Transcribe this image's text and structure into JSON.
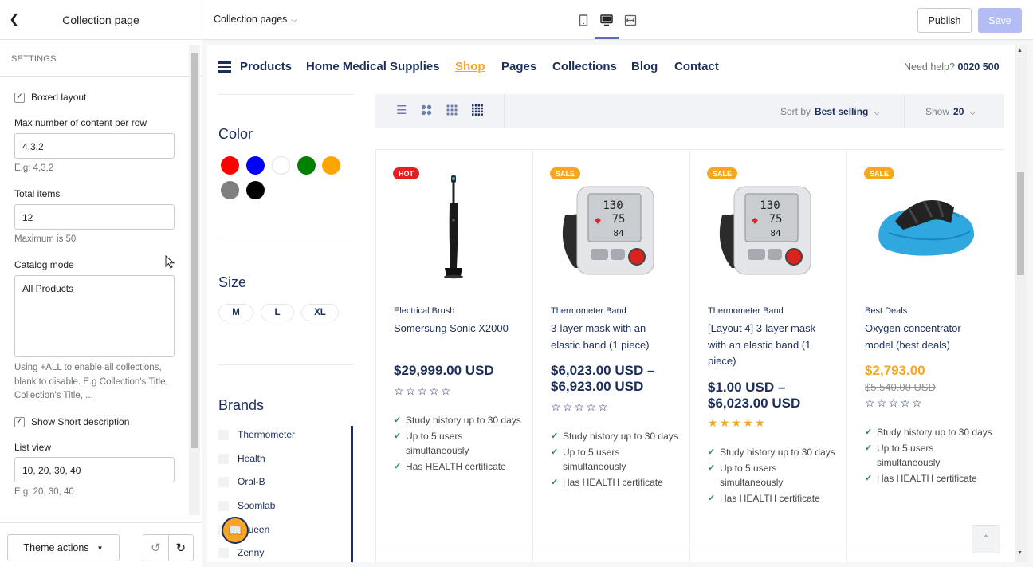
{
  "header": {
    "back_icon": "chevron-left-icon",
    "title": "Collection page"
  },
  "settings": {
    "section_title": "SETTINGS",
    "boxed_layout": {
      "label": "Boxed layout",
      "checked": true
    },
    "max_per_row": {
      "label": "Max number of content per row",
      "value": "4,3,2",
      "hint": "E.g: 4,3,2"
    },
    "total_items": {
      "label": "Total items",
      "value": "12",
      "hint": "Maximum is 50"
    },
    "catalog_mode": {
      "label": "Catalog mode",
      "value": "All Products",
      "hint": "Using +ALL to enable all collections, blank to disable. E.g Collection's Title, Collection's Title, ..."
    },
    "short_desc": {
      "label": "Show Short description",
      "checked": true
    },
    "list_view": {
      "label": "List view",
      "value": "10, 20, 30, 40",
      "hint": "E.g: 20, 30, 40"
    }
  },
  "footer": {
    "theme_actions": "Theme actions",
    "undo_icon": "undo-icon",
    "redo_icon": "redo-icon"
  },
  "topbar": {
    "template_selector": "Collection pages",
    "devices": [
      "mobile-icon",
      "desktop-icon",
      "fullwidth-icon"
    ],
    "active_device": "desktop",
    "publish": "Publish",
    "save": "Save"
  },
  "store": {
    "nav": [
      "Products",
      "Home Medical Supplies",
      "Shop",
      "Pages",
      "Collections",
      "Blog",
      "Contact"
    ],
    "active_nav": "Shop",
    "help_text": "Need help?",
    "help_phone": "0020 500",
    "filters": {
      "color_title": "Color",
      "colors": [
        "#ff0000",
        "#0000ff",
        "#ffffff",
        "#008000",
        "#ffa500",
        "#808080",
        "#000000"
      ],
      "size_title": "Size",
      "sizes": [
        "M",
        "L",
        "XL"
      ],
      "brands_title": "Brands",
      "brands": [
        "Thermometer",
        "Health",
        "Oral-B",
        "Soomlab",
        "Yqueen",
        "Zenny"
      ]
    },
    "toolbar": {
      "sort_label": "Sort by",
      "sort_value": "Best selling",
      "show_label": "Show",
      "show_value": "20"
    },
    "products": [
      {
        "badge": "HOT",
        "category": "Electrical Brush",
        "name": "Somersung Sonic X2000",
        "price": "$29,999.00 USD",
        "rating": 0,
        "features": [
          "Study history up to 30 days",
          "Up to 5 users simultaneously",
          "Has HEALTH certificate"
        ]
      },
      {
        "badge": "SALE",
        "category": "Thermometer Band",
        "name": "3-layer mask with an elastic band (1 piece)",
        "price": "$6,023.00 USD – $6,923.00 USD",
        "rating": 0,
        "features": [
          "Study history up to 30 days",
          "Up to 5 users simultaneously",
          "Has HEALTH certificate"
        ]
      },
      {
        "badge": "SALE",
        "category": "Thermometer Band",
        "name": "[Layout 4] 3-layer mask with an elastic band (1 piece)",
        "price": "$1.00 USD – $6,023.00 USD",
        "rating": 5,
        "features": [
          "Study history up to 30 days",
          "Up to 5 users simultaneously",
          "Has HEALTH certificate"
        ]
      },
      {
        "badge": "SALE",
        "category": "Best Deals",
        "name": "Oxygen concentrator model (best deals)",
        "price": "$2,793.00",
        "old_price": "$5,540.00 USD",
        "rating": 0,
        "features": [
          "Study history up to 30 days",
          "Up to 5 users simultaneously",
          "Has HEALTH certificate"
        ]
      }
    ]
  }
}
